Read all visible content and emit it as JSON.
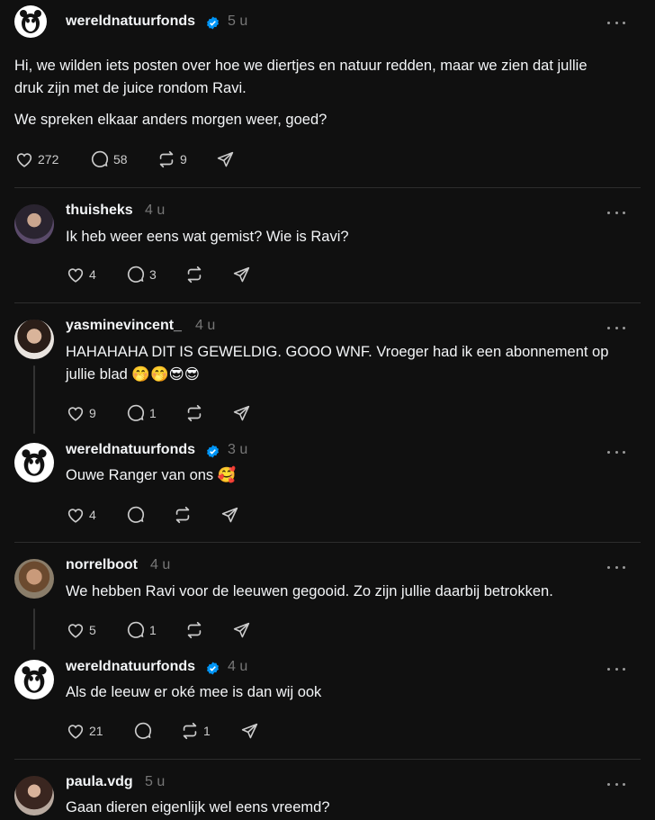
{
  "post": {
    "author": "wereldnatuurfonds",
    "time": "5 u",
    "paragraphs": [
      "Hi, we wilden iets posten over hoe we diertjes en natuur redden, maar we zien dat jullie druk zijn met de juice rondom Ravi.",
      "We spreken elkaar anders morgen weer, goed?"
    ],
    "likes": "272",
    "comments": "58",
    "reposts": "9"
  },
  "replies": [
    {
      "author": "thuisheks",
      "time": "4 u",
      "text": "Ik heb weer eens wat gemist? Wie is Ravi?",
      "likes": "4",
      "comments": "3",
      "reposts": ""
    },
    {
      "author": "yasminevincent_",
      "time": "4 u",
      "text": "HAHAHAHA DIT IS GEWELDIG. GOOO WNF. Vroeger had ik een abonnement op",
      "text2": "jullie blad",
      "emojis": [
        "🤭",
        "🤭",
        "😎",
        "😎"
      ],
      "likes": "9",
      "comments": "1",
      "reposts": ""
    },
    {
      "author": "wereldnatuurfonds",
      "time": "3 u",
      "text": "Ouwe Ranger van ons",
      "emojis": [
        "🥰"
      ],
      "likes": "4",
      "comments": "",
      "reposts": ""
    },
    {
      "author": "norrelboot",
      "time": "4 u",
      "text": "We hebben Ravi voor de leeuwen gegooid. Zo zijn jullie daarbij betrokken.",
      "likes": "5",
      "comments": "1",
      "reposts": ""
    },
    {
      "author": "wereldnatuurfonds",
      "time": "4 u",
      "text": "Als de leeuw er oké mee is dan wij ook",
      "likes": "21",
      "comments": "",
      "reposts": "1"
    },
    {
      "author": "paula.vdg",
      "time": "5 u",
      "text": "Gaan dieren eigenlijk wel eens vreemd?"
    }
  ],
  "colors": {
    "background": "#101010",
    "text": "#f3f5f7",
    "muted": "#777777",
    "verified": "#0095f6"
  }
}
